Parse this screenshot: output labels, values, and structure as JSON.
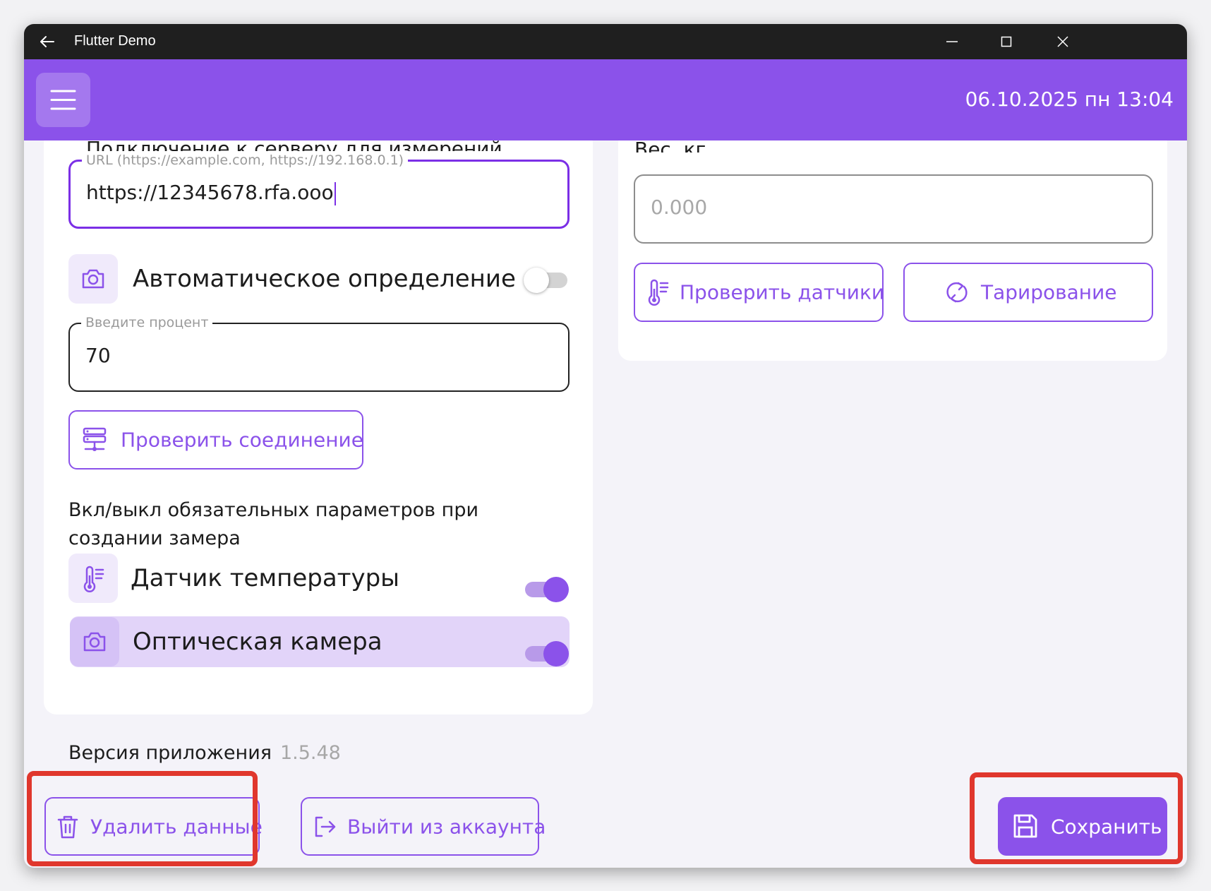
{
  "window": {
    "title": "Flutter Demo"
  },
  "appbar": {
    "datetime": "06.10.2025 пн 13:04"
  },
  "left_card": {
    "clipped_heading": "Подключение к серверу для измерений",
    "url_field": {
      "label": "URL (https://example.com, https://192.168.0.1)",
      "value": "https://12345678.rfa.ooo"
    },
    "auto_detect": {
      "label": "Автоматическое определение",
      "enabled": false
    },
    "percent_field": {
      "label": "Введите процент",
      "value": "70"
    },
    "check_connection_label": "Проверить соединение",
    "required_params_text": "Вкл/выкл обязательных параметров при создании замера",
    "temp_sensor": {
      "label": "Датчик температуры",
      "enabled": true
    },
    "optical_camera": {
      "label": "Оптическая камера",
      "enabled": true
    }
  },
  "right_card": {
    "clipped_heading": "Вес, кг",
    "weight_field": {
      "placeholder": "0.000"
    },
    "check_sensors_label": "Проверить датчики",
    "tare_label": "Тарирование"
  },
  "version": {
    "label": "Версия приложения",
    "number": "1.5.48"
  },
  "footer": {
    "delete_label": "Удалить данные",
    "logout_label": "Выйти из аккаунта",
    "save_label": "Сохранить"
  },
  "colors": {
    "accent": "#8b52ea",
    "focus": "#7b2fe6",
    "highlight": "#e2d4f9",
    "annotation": "#e0372d",
    "titlebar": "#1f1f1f"
  },
  "icons": [
    "back-arrow-icon",
    "minimize-icon",
    "maximize-icon",
    "close-icon",
    "menu-icon",
    "camera-icon",
    "server-icon",
    "thermometer-icon",
    "refresh-icon",
    "trash-icon",
    "logout-icon",
    "save-icon"
  ]
}
